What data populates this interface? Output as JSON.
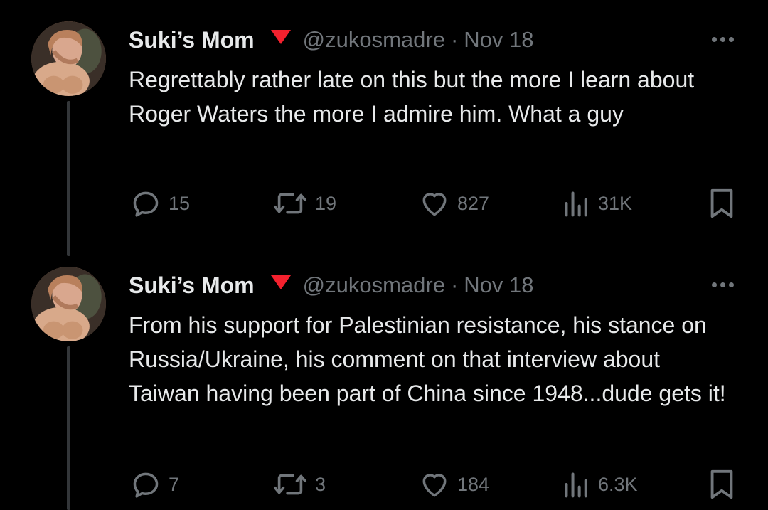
{
  "colors": {
    "background": "#000000",
    "text_primary": "#e7e9ea",
    "text_secondary": "#71767b",
    "thread_line": "#333639",
    "badge": "#f4212e"
  },
  "tweets": [
    {
      "author": {
        "display_name": "Suki’s Mom",
        "badge_icon": "red-triangle-icon",
        "handle": "@zukosmadre"
      },
      "separator": "·",
      "date": "Nov 18",
      "text": "Regrettably rather late on this but the more I learn about Roger Waters the more I admire him. What a guy",
      "stats": {
        "replies": "15",
        "retweets": "19",
        "likes": "827",
        "views": "31K"
      }
    },
    {
      "author": {
        "display_name": "Suki’s Mom",
        "badge_icon": "red-triangle-icon",
        "handle": "@zukosmadre"
      },
      "separator": "·",
      "date": "Nov 18",
      "text": "From his support for Palestinian resistance, his stance on Russia/Ukraine, his comment on that interview about Taiwan having been part of China since 1948...dude gets it!",
      "stats": {
        "replies": "7",
        "retweets": "3",
        "likes": "184",
        "views": "6.3K"
      }
    }
  ]
}
